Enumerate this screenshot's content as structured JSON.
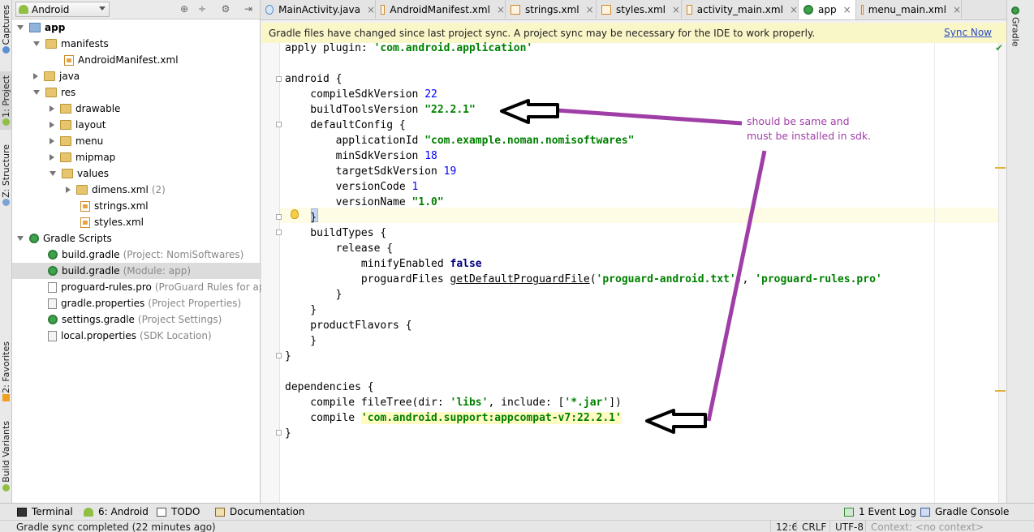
{
  "left_strip": {
    "tabs": [
      "Captures",
      "1: Project",
      "Z: Structure",
      "2: Favorites",
      "Build Variants"
    ]
  },
  "project_panel": {
    "view_selector": "Android",
    "tree": [
      {
        "label": "app",
        "hint": "",
        "bold": true
      },
      {
        "label": "manifests",
        "hint": ""
      },
      {
        "label": "AndroidManifest.xml",
        "hint": ""
      },
      {
        "label": "java",
        "hint": ""
      },
      {
        "label": "res",
        "hint": ""
      },
      {
        "label": "drawable",
        "hint": ""
      },
      {
        "label": "layout",
        "hint": ""
      },
      {
        "label": "menu",
        "hint": ""
      },
      {
        "label": "mipmap",
        "hint": ""
      },
      {
        "label": "values",
        "hint": ""
      },
      {
        "label": "dimens.xml",
        "hint": "(2)"
      },
      {
        "label": "strings.xml",
        "hint": ""
      },
      {
        "label": "styles.xml",
        "hint": ""
      },
      {
        "label": "Gradle Scripts",
        "hint": ""
      },
      {
        "label": "build.gradle",
        "hint": "(Project: NomiSoftwares)"
      },
      {
        "label": "build.gradle",
        "hint": "(Module: app)"
      },
      {
        "label": "proguard-rules.pro",
        "hint": "(ProGuard Rules for app)"
      },
      {
        "label": "gradle.properties",
        "hint": "(Project Properties)"
      },
      {
        "label": "settings.gradle",
        "hint": "(Project Settings)"
      },
      {
        "label": "local.properties",
        "hint": "(SDK Location)"
      }
    ]
  },
  "tabs": [
    {
      "label": "MainActivity.java",
      "icon": "class-icon"
    },
    {
      "label": "AndroidManifest.xml",
      "icon": "xml-file-icon"
    },
    {
      "label": "strings.xml",
      "icon": "xml-file-icon"
    },
    {
      "label": "styles.xml",
      "icon": "xml-file-icon"
    },
    {
      "label": "activity_main.xml",
      "icon": "xml-file-icon"
    },
    {
      "label": "app",
      "icon": "gradle-icon",
      "active": true
    },
    {
      "label": "menu_main.xml",
      "icon": "xml-file-icon"
    }
  ],
  "notification": {
    "text": "Gradle files have changed since last project sync. A project sync may be necessary for the IDE to work properly.",
    "action": "Sync Now"
  },
  "editor": {
    "lines": [
      [
        {
          "t": "apply plugin: ",
          "c": ""
        },
        {
          "t": "'com.android.application'",
          "c": "str"
        }
      ],
      [],
      [
        {
          "t": "android {",
          "c": ""
        }
      ],
      [
        {
          "t": "    compileSdkVersion ",
          "c": ""
        },
        {
          "t": "22",
          "c": "num"
        }
      ],
      [
        {
          "t": "    buildToolsVersion ",
          "c": ""
        },
        {
          "t": "\"22.2.1\"",
          "c": "str"
        }
      ],
      [
        {
          "t": "    defaultConfig {",
          "c": ""
        }
      ],
      [
        {
          "t": "        applicationId ",
          "c": ""
        },
        {
          "t": "\"com.example.noman.nomisoftwares\"",
          "c": "str"
        }
      ],
      [
        {
          "t": "        minSdkVersion ",
          "c": ""
        },
        {
          "t": "18",
          "c": "num"
        }
      ],
      [
        {
          "t": "        targetSdkVersion ",
          "c": ""
        },
        {
          "t": "19",
          "c": "num"
        }
      ],
      [
        {
          "t": "        versionCode ",
          "c": ""
        },
        {
          "t": "1",
          "c": "num"
        }
      ],
      [
        {
          "t": "        versionName ",
          "c": ""
        },
        {
          "t": "\"1.0\"",
          "c": "str"
        }
      ],
      [
        {
          "t": "    }",
          "c": ""
        }
      ],
      [
        {
          "t": "    buildTypes {",
          "c": ""
        }
      ],
      [
        {
          "t": "        release {",
          "c": ""
        }
      ],
      [
        {
          "t": "            minifyEnabled ",
          "c": ""
        },
        {
          "t": "false",
          "c": "kw"
        }
      ],
      [
        {
          "t": "            proguardFiles ",
          "c": ""
        },
        {
          "t": "getDefaultProguardFile",
          "c": "u"
        },
        {
          "t": "(",
          "c": ""
        },
        {
          "t": "'proguard-android.txt'",
          "c": "str"
        },
        {
          "t": "), ",
          "c": ""
        },
        {
          "t": "'proguard-rules.pro'",
          "c": "str"
        }
      ],
      [
        {
          "t": "        }",
          "c": ""
        }
      ],
      [
        {
          "t": "    }",
          "c": ""
        }
      ],
      [
        {
          "t": "    productFlavors {",
          "c": ""
        }
      ],
      [
        {
          "t": "    }",
          "c": ""
        }
      ],
      [
        {
          "t": "}",
          "c": ""
        }
      ],
      [],
      [
        {
          "t": "dependencies {",
          "c": ""
        }
      ],
      [
        {
          "t": "    compile fileTree(dir: ",
          "c": ""
        },
        {
          "t": "'libs'",
          "c": "str"
        },
        {
          "t": ", include: [",
          "c": ""
        },
        {
          "t": "'*.jar'",
          "c": "str"
        },
        {
          "t": "])",
          "c": ""
        }
      ],
      [
        {
          "t": "    compile ",
          "c": ""
        },
        {
          "t": "'com.android.support:appcompat-v7:22.2.1'",
          "c": "str hl"
        }
      ],
      [
        {
          "t": "}",
          "c": ""
        }
      ]
    ]
  },
  "annotation": {
    "note": "should be same and\nmust be installed in sdk.",
    "color": "#a03ea8"
  },
  "right_strip": {
    "tab": "Gradle"
  },
  "bottom_tabs": [
    {
      "label": "Terminal",
      "icon": "terminal-icon"
    },
    {
      "label": "6: Android",
      "icon": "android-icon"
    },
    {
      "label": "TODO",
      "icon": "todo-icon"
    },
    {
      "label": "Documentation",
      "icon": "documentation-icon"
    },
    {
      "label": "1 Event Log",
      "icon": "event-log-icon"
    },
    {
      "label": "Gradle Console",
      "icon": "gradle-console-icon"
    }
  ],
  "status_bar": {
    "message": "Gradle sync completed (22 minutes ago)",
    "position": "12:6",
    "line_separator": "CRLF",
    "encoding": "UTF-8",
    "context": "Context: <no context>"
  }
}
